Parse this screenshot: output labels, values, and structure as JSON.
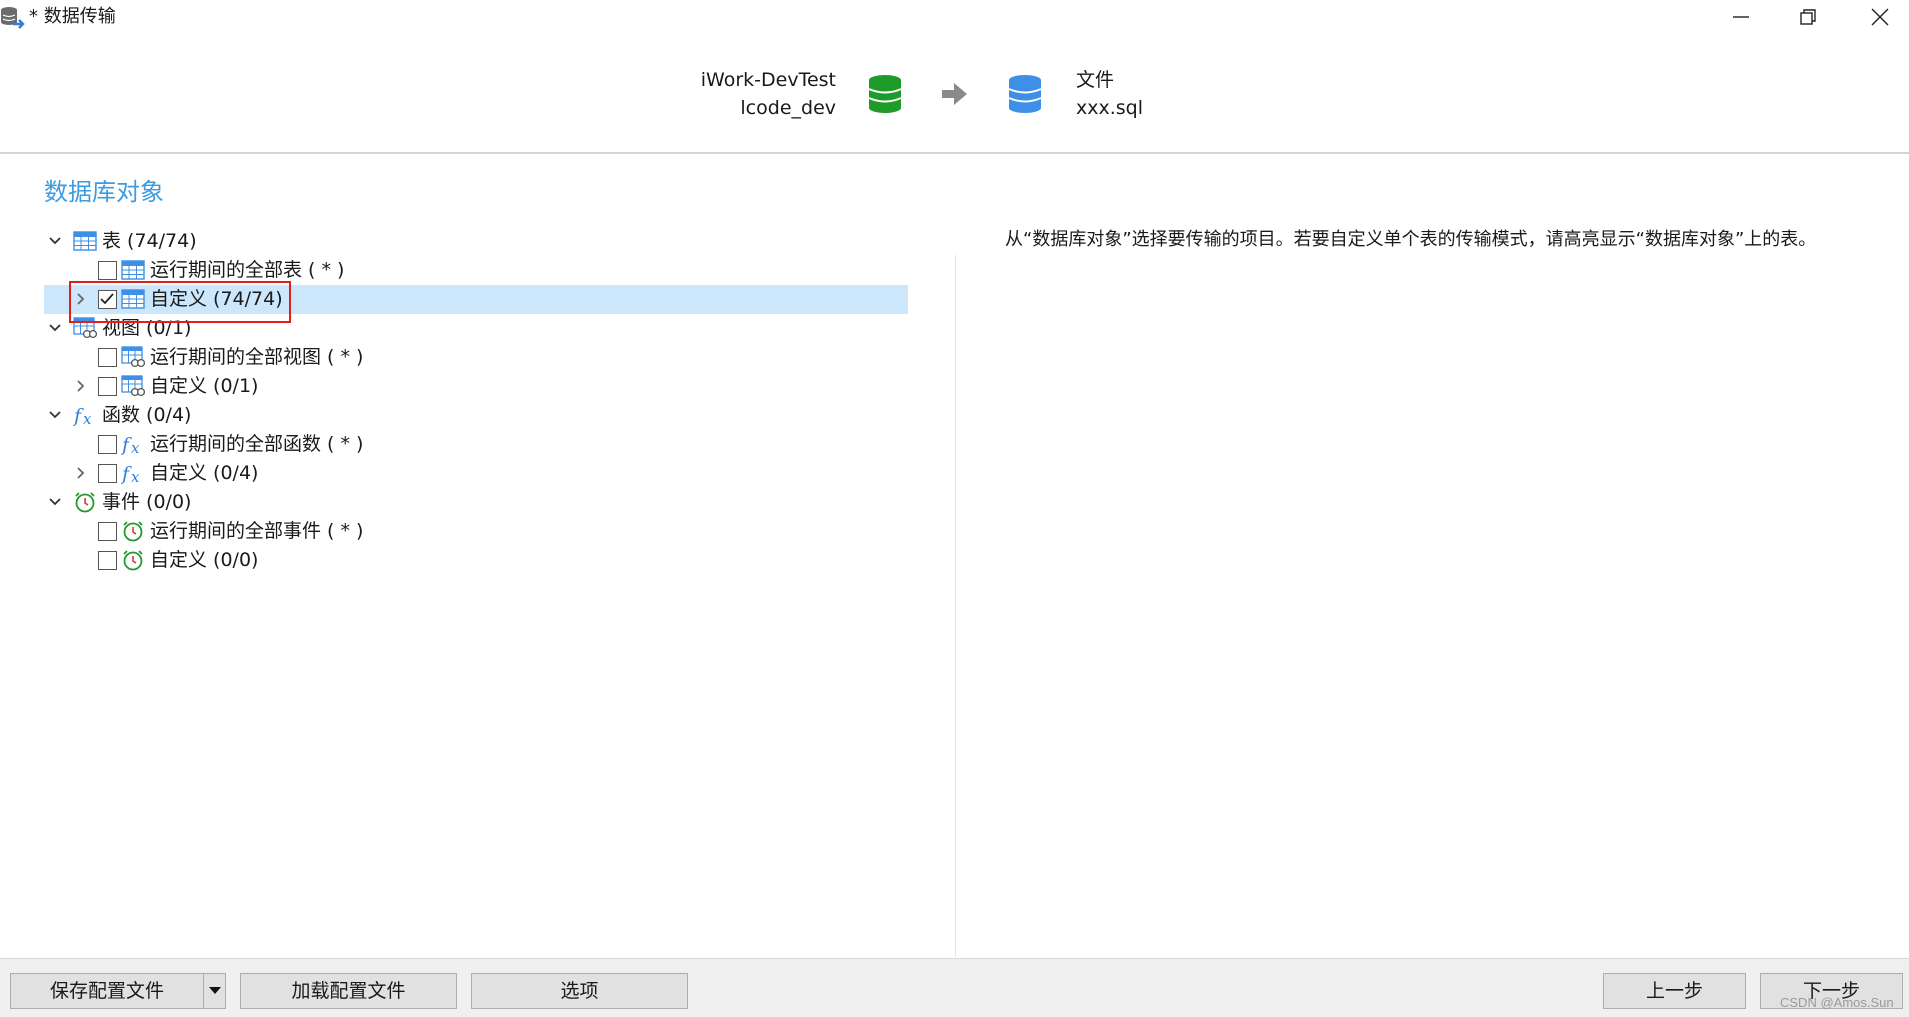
{
  "window": {
    "title": "* 数据传输",
    "buttons": [
      "minimize",
      "maximize",
      "close"
    ]
  },
  "header": {
    "source": {
      "connection": "iWork-DevTest",
      "database": "lcode_dev",
      "icon": "database-green-icon",
      "color": "#1f9b2a"
    },
    "arrow_icon": "arrow-right-icon",
    "target": {
      "connection": "文件",
      "database": "xxx.sql",
      "icon": "database-blue-icon",
      "color": "#3d8fe8"
    }
  },
  "section_title": "数据库对象",
  "tree": {
    "tables": {
      "label": "表 (74/74)",
      "expanded": true,
      "children": [
        {
          "label": "运行期间的全部表 ( * )",
          "checked": false,
          "has_chevron": false
        },
        {
          "label": "自定义 (74/74)",
          "checked": true,
          "has_chevron": true,
          "selected": true
        }
      ]
    },
    "views": {
      "label": "视图 (0/1)",
      "expanded": true,
      "children": [
        {
          "label": "运行期间的全部视图 ( * )",
          "checked": false,
          "has_chevron": false
        },
        {
          "label": "自定义 (0/1)",
          "checked": false,
          "has_chevron": true
        }
      ]
    },
    "functions": {
      "label": "函数 (0/4)",
      "expanded": true,
      "children": [
        {
          "label": "运行期间的全部函数 ( * )",
          "checked": false,
          "has_chevron": false
        },
        {
          "label": "自定义 (0/4)",
          "checked": false,
          "has_chevron": true
        }
      ]
    },
    "events": {
      "label": "事件 (0/0)",
      "expanded": true,
      "children": [
        {
          "label": "运行期间的全部事件 ( * )",
          "checked": false,
          "has_chevron": false
        },
        {
          "label": "自定义 (0/0)",
          "checked": false,
          "has_chevron": false
        }
      ]
    }
  },
  "hint_text": "从“数据库对象”选择要传输的项目。若要自定义单个表的传输模式，请高亮显示“数据库对象”上的表。",
  "footer": {
    "save_profile": "保存配置文件",
    "load_profile": "加载配置文件",
    "options": "选项",
    "back": "上一步",
    "next": "下一步"
  },
  "watermark": "CSDN @Amos.Sun",
  "colors": {
    "accent": "#3d9be0",
    "selection": "#cce6fb",
    "highlight_box": "#e0201c"
  }
}
